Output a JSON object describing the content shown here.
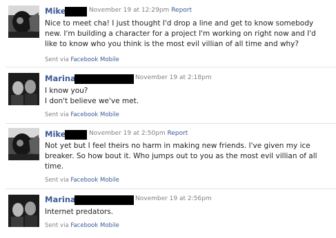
{
  "messages": [
    {
      "sender": "Mike",
      "timestamp": "November 19 at 12:29pm",
      "report_label": "Report",
      "lines": [
        "Nice to meet cha! I just thought I'd drop a line and get to know somebody",
        "new. I'm building a character for a project I'm working on right now and I'd",
        "like to know who you think is the most evil villian of all time and why?"
      ],
      "sent_prefix": "Sent via",
      "sent_link": "Facebook Mobile"
    },
    {
      "sender": "Marina",
      "timestamp": "November 19 at 2:18pm",
      "report_label": "",
      "lines": [
        "I know you?",
        "I don't believe we've met."
      ],
      "sent_prefix": "Sent via",
      "sent_link": "Facebook Mobile"
    },
    {
      "sender": "Mike",
      "timestamp": "November 19 at 2:50pm",
      "report_label": "Report",
      "lines": [
        "Not yet but I feel theirs no harm in making new friends. I've given my ice",
        "breaker. So how bout it. Who jumps out to you as the most evil villian of all",
        "time."
      ],
      "sent_prefix": "Sent via",
      "sent_link": "Facebook Mobile"
    },
    {
      "sender": "Marina",
      "timestamp": "November 19 at 2:56pm",
      "report_label": "",
      "lines": [
        "Internet predators."
      ],
      "sent_prefix": "Sent via",
      "sent_link": "Facebook Mobile"
    }
  ],
  "colors": {
    "link": "#3b5998",
    "meta": "#808080",
    "redaction": "#000000"
  }
}
